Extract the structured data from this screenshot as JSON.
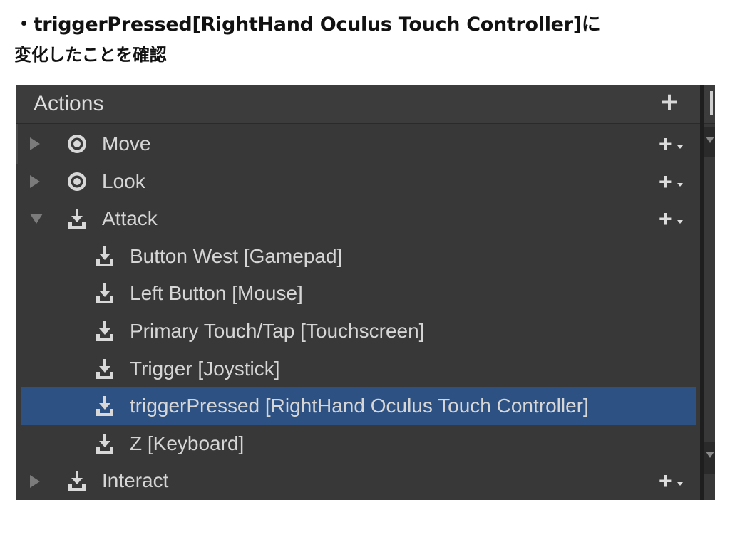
{
  "caption": {
    "line1": "・triggerPressed[RightHand Oculus Touch Controller]に",
    "line2": "変化したことを確認"
  },
  "panel": {
    "title": "Actions",
    "add_label": "+"
  },
  "tree": [
    {
      "label": "Move",
      "level": 0,
      "icon": "value-action-icon",
      "arrow": "collapsed",
      "plus": true
    },
    {
      "label": "Look",
      "level": 0,
      "icon": "value-action-icon",
      "arrow": "collapsed",
      "plus": true
    },
    {
      "label": "Attack",
      "level": 0,
      "icon": "button-action-icon",
      "arrow": "expanded",
      "plus": true
    },
    {
      "label": "Button West [Gamepad]",
      "level": 1,
      "icon": "binding-icon"
    },
    {
      "label": "Left Button [Mouse]",
      "level": 1,
      "icon": "binding-icon"
    },
    {
      "label": "Primary Touch/Tap [Touchscreen]",
      "level": 1,
      "icon": "binding-icon"
    },
    {
      "label": "Trigger [Joystick]",
      "level": 1,
      "icon": "binding-icon"
    },
    {
      "label": "triggerPressed [RightHand Oculus Touch Controller]",
      "level": 1,
      "icon": "binding-icon",
      "selected": true
    },
    {
      "label": "Z [Keyboard]",
      "level": 1,
      "icon": "binding-icon"
    },
    {
      "label": "Interact",
      "level": 0,
      "icon": "button-action-icon",
      "arrow": "collapsed",
      "plus": true
    }
  ],
  "colors": {
    "panel_bg": "#383838",
    "selection": "#2d5183",
    "text": "#d6d6d6"
  }
}
